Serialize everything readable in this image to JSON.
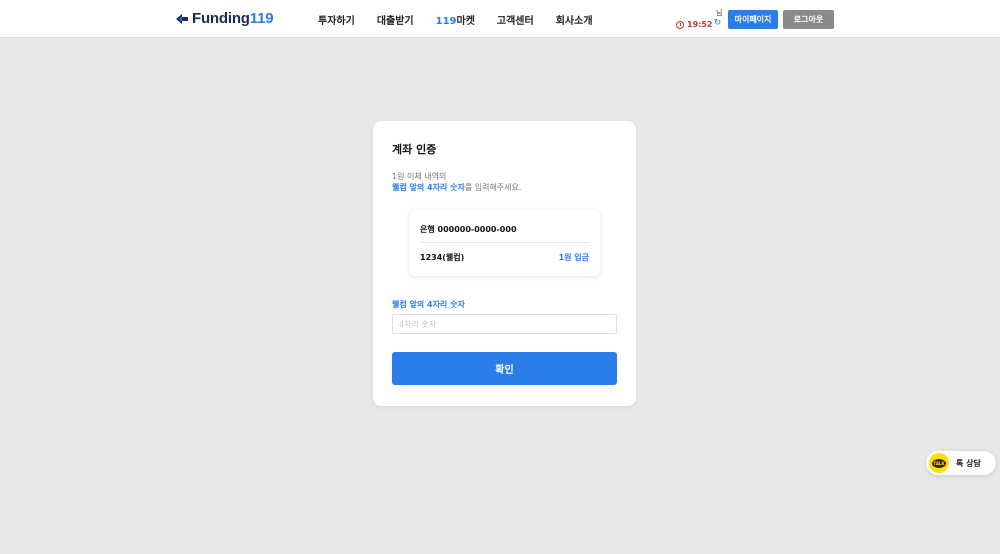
{
  "header": {
    "logo_word": "Funding",
    "logo_number": "119",
    "nav": [
      {
        "label": "투자하기"
      },
      {
        "label": "대출받기"
      },
      {
        "label_highlight": "119",
        "label": "마켓"
      },
      {
        "label": "고객센터"
      },
      {
        "label": "회사소개"
      }
    ],
    "user_suffix": "님",
    "timer": "19:52",
    "mypage_label": "마이페이지",
    "logout_label": "로그아웃"
  },
  "card": {
    "title": "계좌 인증",
    "desc_line1": "1원 이체 내역의",
    "desc_line2_highlight": "웰컴 앞의 4자리 숫자",
    "desc_line2_rest": "를 입력해주세요.",
    "bank_account": "은행 000000-0000-000",
    "sender": "1234(웰컴)",
    "amount": "1원 입금",
    "input_label": "웰컴 앞의 4자리 숫자",
    "input_placeholder": "4자리 숫자",
    "input_value": "",
    "confirm_label": "확인"
  },
  "talk": {
    "icon_text": "TALK",
    "label": "톡 상담"
  },
  "colors": {
    "accent": "#2b7de9",
    "timer": "#c0392b",
    "logout": "#8a8a8a",
    "kakao": "#fae100"
  }
}
